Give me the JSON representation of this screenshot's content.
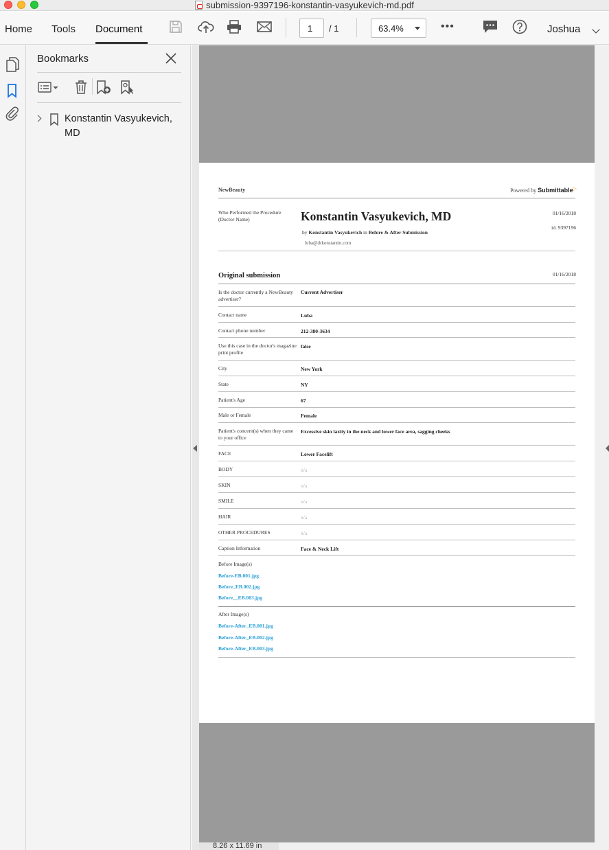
{
  "window": {
    "title": "submission-9397196-konstantin-vasyukevich-md.pdf"
  },
  "toolbar": {
    "tabs": [
      {
        "label": "Home"
      },
      {
        "label": "Tools"
      },
      {
        "label": "Document"
      }
    ],
    "page_current": "1",
    "page_total": "/  1",
    "zoom": "63.4%",
    "more": "•••",
    "user": "Joshua"
  },
  "bookmarks": {
    "title": "Bookmarks",
    "items": [
      {
        "label": "Konstantin Vasyukevich, MD"
      }
    ]
  },
  "viewer": {
    "page_size": "8.26 x 11.69 in"
  },
  "document": {
    "brand": "NewBeauty",
    "powered_by": "Powered by",
    "powered_brand": "Submittable",
    "header_label": "Who Performed the Procedure (Doctor Name)",
    "doctor_name": "Konstantin Vasyukevich, MD",
    "byline_by": "by",
    "byline_author": "Konstantin Vasyukevich",
    "byline_in": "in",
    "byline_form": "Before & After Submission",
    "email": "luba@drkonstantin.com",
    "date": "01/16/2018",
    "id": "id. 9397196",
    "section_title": "Original submission",
    "section_date": "01/16/2018",
    "fields": [
      {
        "label": "Is the doctor currently a NewBeauty advertiser?",
        "value": "Current Advertiser"
      },
      {
        "label": "Contact name",
        "value": "Luba"
      },
      {
        "label": "Contact phone number",
        "value": "212-380-3634"
      },
      {
        "label": "Use this case in the doctor's magazine print profile",
        "value": "false"
      },
      {
        "label": "City",
        "value": "New York"
      },
      {
        "label": "State",
        "value": "NY"
      },
      {
        "label": "Patient's Age",
        "value": "67"
      },
      {
        "label": "Male or Female",
        "value": "Female"
      },
      {
        "label": "Patient's concern(s) when they came to your office",
        "value": "Excessive skin laxity in the neck and lower face area, sagging cheeks"
      },
      {
        "label": "FACE",
        "value": "Lower Facelift"
      },
      {
        "label": "BODY",
        "value": "n/a"
      },
      {
        "label": "SKIN",
        "value": "n/a"
      },
      {
        "label": "SMILE",
        "value": "n/a"
      },
      {
        "label": "HAIR",
        "value": "n/a"
      },
      {
        "label": "OTHER PROCEDURES",
        "value": "n/a"
      },
      {
        "label": "Caption Information",
        "value": "Face & Neck Lift"
      }
    ],
    "before_label": "Before Image(s)",
    "before_files": [
      "Before-EB.001.jpg",
      "Before_EB.002.jpg",
      "Before__EB.003.jpg"
    ],
    "after_label": "After Image(s)",
    "after_files": [
      "Before-After_EB.001.jpg",
      "Before-After_EB.002.jpg",
      "Before-After_EB.003.jpg"
    ]
  },
  "colors": {
    "link": "#2a9fd6",
    "page_gray": "#9a9a9a",
    "bookmark_active": "#1473e6"
  }
}
